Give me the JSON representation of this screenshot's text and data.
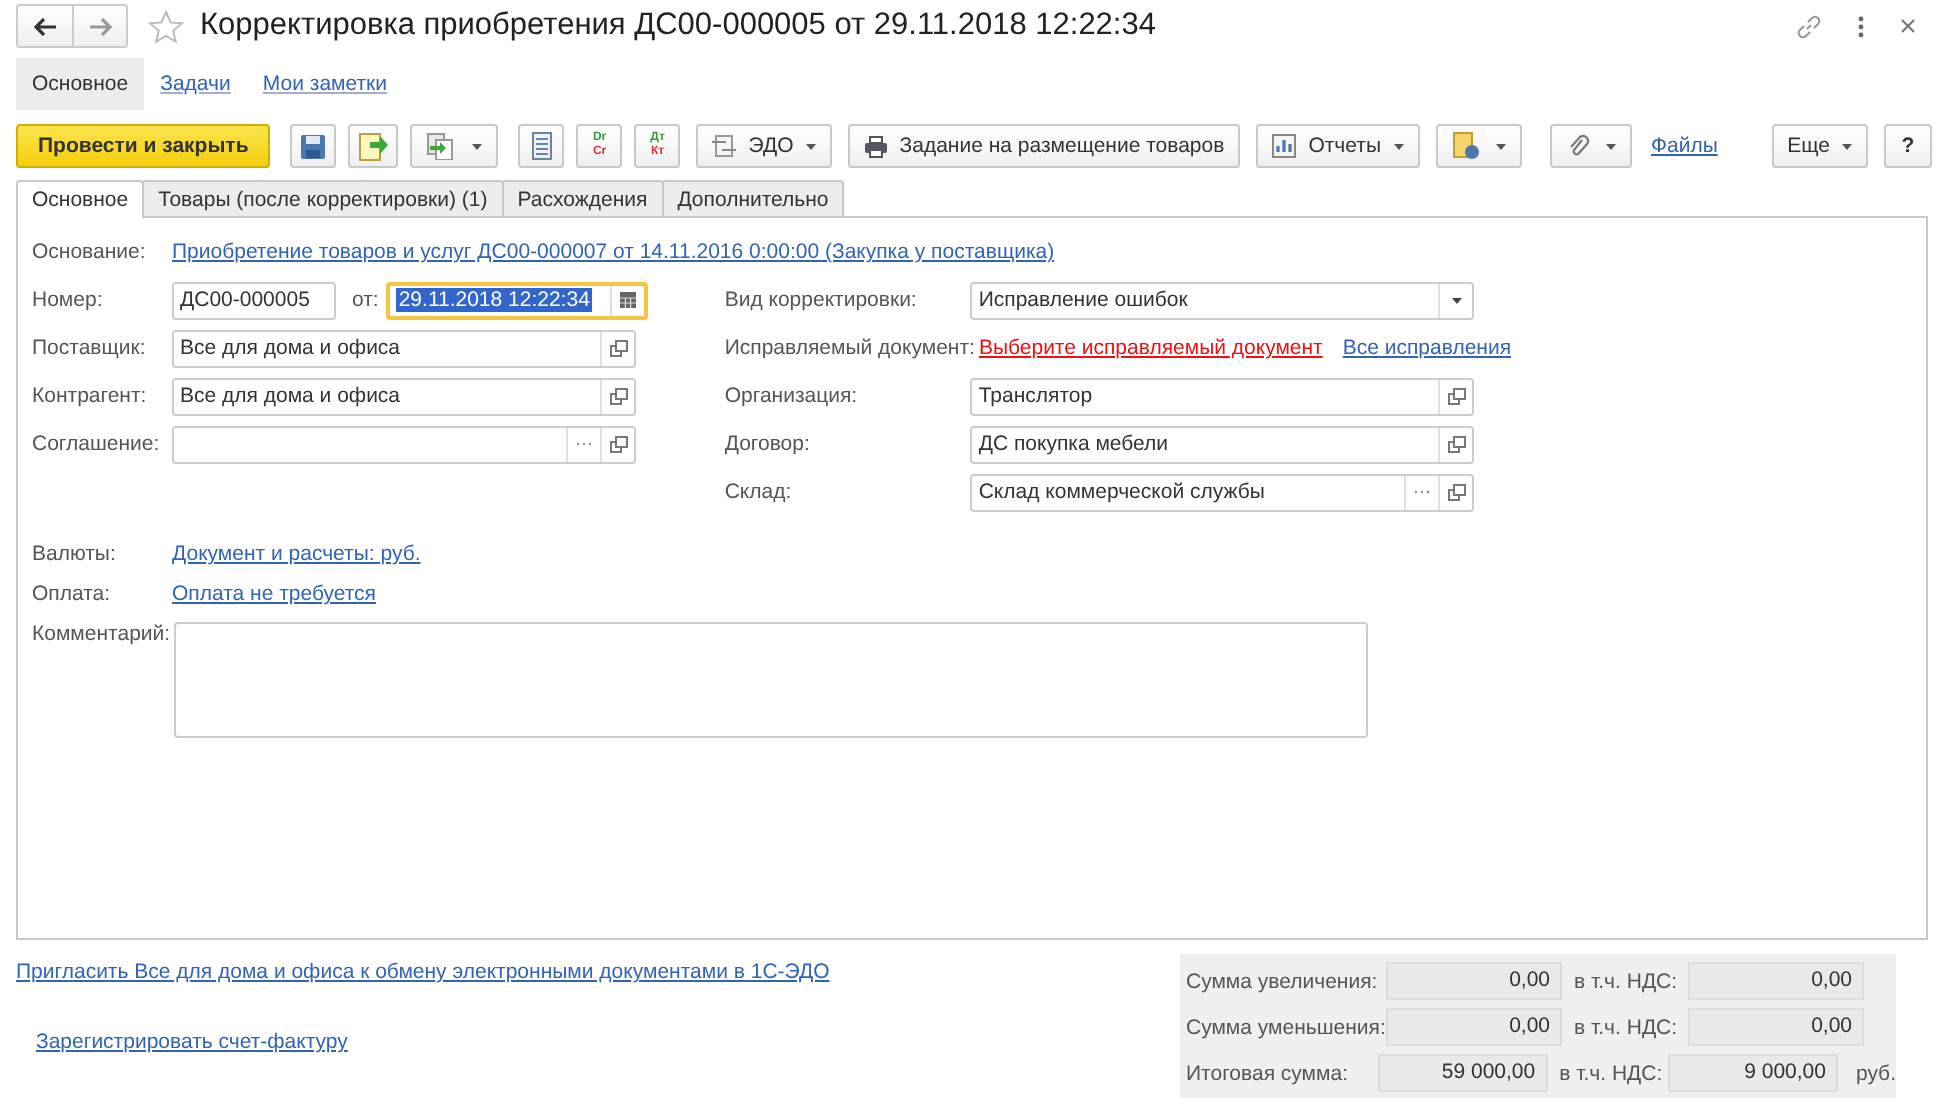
{
  "window": {
    "title": "Корректировка приобретения ДС00-000005 от 29.11.2018 12:22:34"
  },
  "nav_tabs": [
    {
      "label": "Основное",
      "selected": true
    },
    {
      "label": "Задачи",
      "selected": false
    },
    {
      "label": "Мои заметки",
      "selected": false
    }
  ],
  "toolbar": {
    "primary": "Провести и закрыть",
    "journal_buttons": [
      {
        "top": "Dr",
        "bottom": "Cr"
      },
      {
        "top": "Дт",
        "bottom": "Кт"
      }
    ],
    "edo": "ЭДО",
    "task": "Задание на размещение товаров",
    "reports": "Отчеты",
    "files": "Файлы",
    "more": "Еще",
    "help": "?"
  },
  "tabs": [
    {
      "label": "Основное",
      "selected": true
    },
    {
      "label": "Товары (после корректировки) (1)",
      "selected": false
    },
    {
      "label": "Расхождения",
      "selected": false
    },
    {
      "label": "Дополнительно",
      "selected": false
    }
  ],
  "form": {
    "basis": {
      "label": "Основание:",
      "link": "Приобретение товаров и услуг ДС00-000007 от 14.11.2016 0:00:00 (Закупка у поставщика)"
    },
    "number": {
      "label": "Номер:",
      "value": "ДС00-000005"
    },
    "date": {
      "label": "от:",
      "value": "29.11.2018 12:22:34",
      "focused": true
    },
    "left_fields": [
      {
        "label": "Поставщик:",
        "value": "Все для дома и офиса",
        "kind": "open"
      },
      {
        "label": "Контрагент:",
        "value": "Все для дома и офиса",
        "kind": "open"
      },
      {
        "label": "Соглашение:",
        "kind": "select-open"
      }
    ],
    "right_fields": [
      {
        "label": "Вид корректировки:",
        "value": "Исправление ошибок",
        "kind": "dropdown"
      },
      {
        "label": "Исправляемый документ:",
        "kind": "links",
        "warning_link": "Выберите исправляемый документ",
        "link": "Все исправления"
      },
      {
        "label": "Организация:",
        "value": "Транслятор",
        "kind": "open"
      },
      {
        "label": "Договор:",
        "value": "ДС покупка мебели",
        "kind": "open"
      },
      {
        "label": "Склад:",
        "value": "Склад коммерческой службы",
        "kind": "select-open"
      }
    ],
    "currency": {
      "label": "Валюты:",
      "link": "Документ и расчеты: руб."
    },
    "payment": {
      "label": "Оплата:",
      "link": "Оплата не требуется"
    },
    "comment": {
      "label": "Комментарий:"
    }
  },
  "footer_links": [
    "Пригласить Все для дома и офиса к обмену электронными документами в 1С-ЭДО",
    "Зарегистрировать счет-фактуру"
  ],
  "totals": [
    {
      "label": "Сумма увеличения:",
      "value": "0,00",
      "vat_label": "в т.ч. НДС:",
      "vat_value": "0,00"
    },
    {
      "label": "Сумма уменьшения:",
      "value": "0,00",
      "vat_label": "в т.ч. НДС:",
      "vat_value": "0,00"
    },
    {
      "label": "Итоговая сумма:",
      "value": "59 000,00",
      "vat_label": "в т.ч. НДС:",
      "vat_value": "9 000,00",
      "unit": "руб."
    }
  ]
}
